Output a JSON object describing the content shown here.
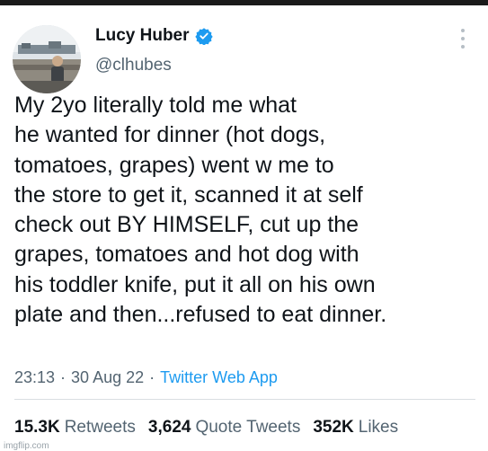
{
  "author": {
    "display_name": "Lucy Huber",
    "handle": "@clhubes",
    "verified": true,
    "verified_color": "#1d9bf0"
  },
  "tweet": {
    "text": "My 2yo literally told me what\nhe wanted for dinner (hot dogs,\ntomatoes, grapes) went w me to\nthe store to get it, scanned it at self\ncheck out BY HIMSELF, cut up the\ngrapes, tomatoes and hot dog with\nhis toddler knife, put it all on his own\nplate and then...refused to eat dinner.",
    "time": "23:13",
    "date": "30 Aug 22",
    "separator": "·",
    "source": "Twitter Web App"
  },
  "stats": {
    "retweets_count": "15.3K",
    "retweets_label": "Retweets",
    "quotes_count": "3,624",
    "quotes_label": "Quote Tweets",
    "likes_count": "352K",
    "likes_label": "Likes"
  },
  "watermark": "imgflip.com",
  "icons": {
    "verified": "verified-badge-icon",
    "more": "more-options-icon"
  }
}
